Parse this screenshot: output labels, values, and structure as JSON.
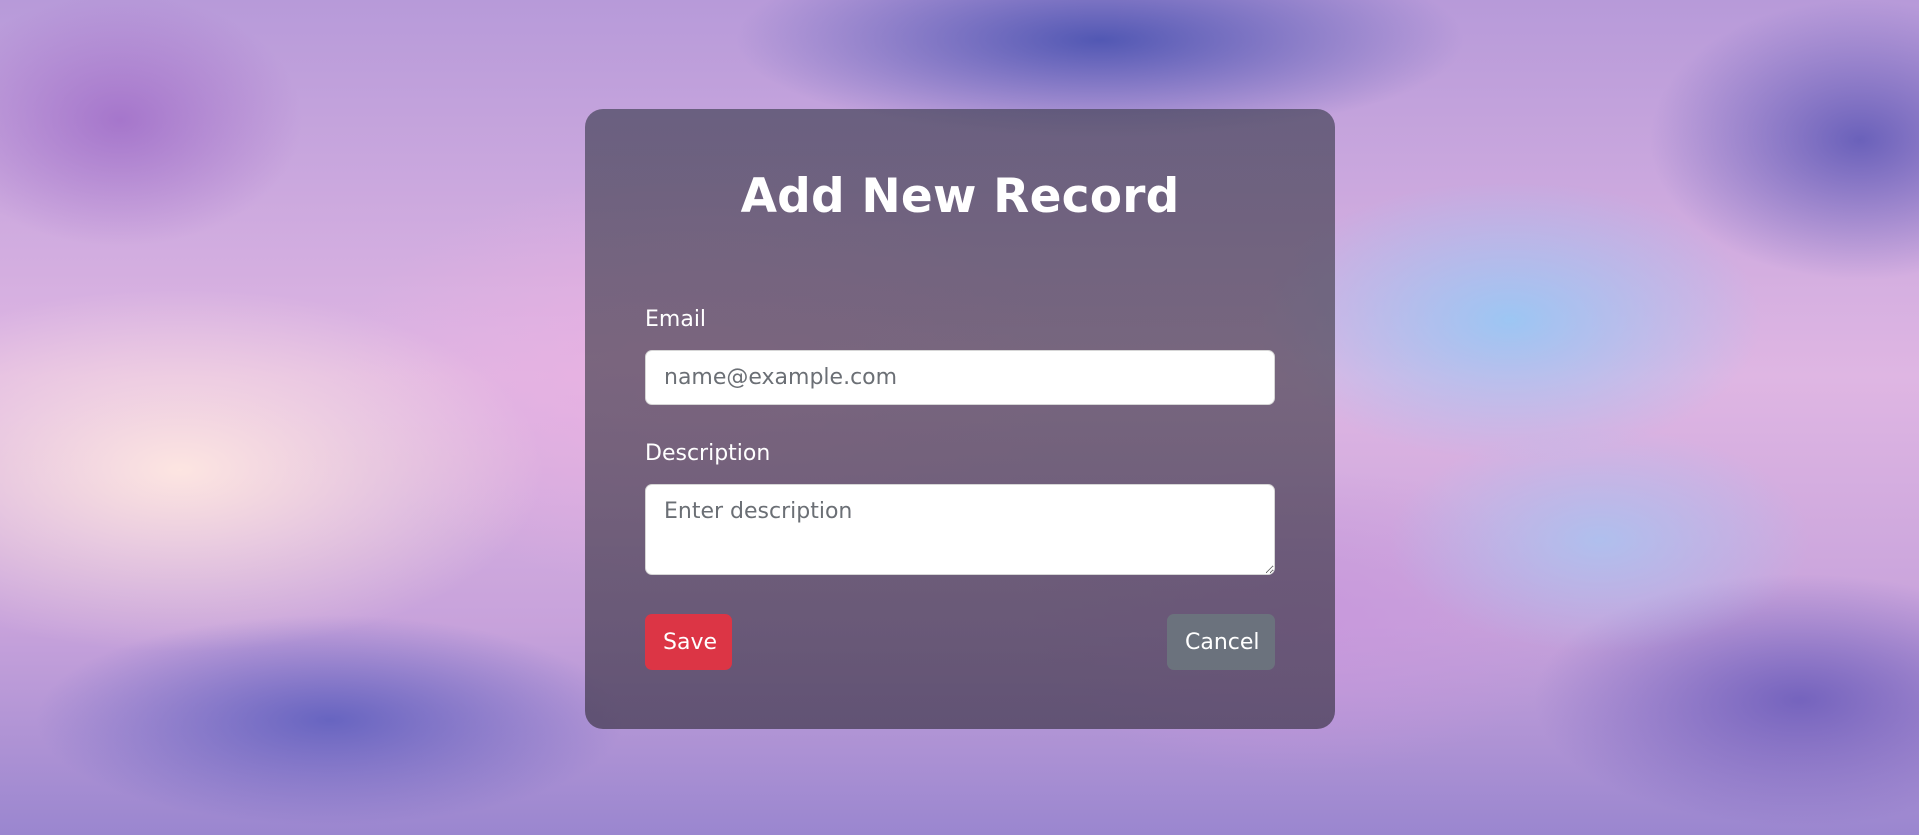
{
  "form": {
    "title": "Add New Record",
    "email_label": "Email",
    "email_placeholder": "name@example.com",
    "email_value": "",
    "description_label": "Description",
    "description_placeholder": "Enter description",
    "description_value": "",
    "save_label": "Save",
    "cancel_label": "Cancel"
  },
  "colors": {
    "save_button": "#dc3545",
    "cancel_button": "#6c757d",
    "card_overlay": "#4a4658"
  }
}
